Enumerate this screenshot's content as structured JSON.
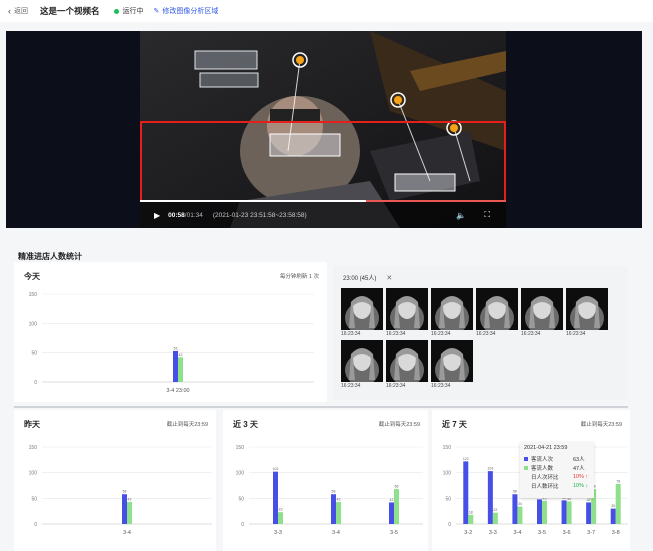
{
  "topbar": {
    "back_label": "返回",
    "video_name": "这是一个视频名",
    "status_label": "运行中",
    "edit_label": "修改图像分析区域"
  },
  "player": {
    "current_time": "00:58",
    "duration": "/01:34",
    "time_range": "(2021-01-23 23:51:58~23:58:58)",
    "progress": 0.617
  },
  "section_title": "精准进店人数统计",
  "colors": {
    "blue": "#4650e6",
    "green": "#8fe08a",
    "accent": "#2f57e8",
    "roi": "#e5201a"
  },
  "panels": {
    "today": {
      "title": "今天",
      "note": "每分钟刷新 1 次"
    },
    "yesterday": {
      "title": "昨天",
      "note": "截止到每天23:59"
    },
    "last3": {
      "title": "近 3 天",
      "note": "截止到每天23:59"
    },
    "last7": {
      "title": "近 7 天",
      "note": "截止到每天23:59"
    }
  },
  "faces": {
    "header": "23:00 (45人)",
    "items": [
      "16:23:34",
      "16:23:34",
      "16:23:34",
      "16:23:34",
      "16:23:34",
      "16:23:34",
      "16:23:34",
      "16:23:34",
      "16:23:34"
    ]
  },
  "tooltip": {
    "title": "2021-04-21 23:59",
    "rows": [
      {
        "label": "客流人次",
        "value": "63人",
        "kind": "blue"
      },
      {
        "label": "客流人数",
        "value": "47人",
        "kind": "green"
      },
      {
        "label": "日人次环比",
        "value": "10% ↑",
        "kind": "up"
      },
      {
        "label": "日人数环比",
        "value": "10% ↓",
        "kind": "down"
      }
    ]
  },
  "chart_data": [
    {
      "type": "bar",
      "panel": "today",
      "categories": [
        "3-4 23:00"
      ],
      "series": [
        {
          "values": [
            53
          ]
        },
        {
          "values": [
            42
          ]
        }
      ],
      "ylim": [
        0,
        150
      ],
      "yticks": [
        0,
        50,
        100,
        150
      ]
    },
    {
      "type": "bar",
      "panel": "yesterday",
      "categories": [
        "3-4"
      ],
      "series": [
        {
          "values": [
            58
          ]
        },
        {
          "values": [
            43
          ]
        }
      ],
      "ylim": [
        0,
        150
      ],
      "yticks": [
        0,
        50,
        100,
        150
      ]
    },
    {
      "type": "bar",
      "panel": "last3",
      "categories": [
        "3-3",
        "3-4",
        "3-5"
      ],
      "series": [
        {
          "values": [
            102,
            58,
            42
          ]
        },
        {
          "values": [
            23,
            43,
            68
          ]
        }
      ],
      "ylim": [
        0,
        150
      ],
      "yticks": [
        0,
        50,
        100,
        150
      ]
    },
    {
      "type": "bar",
      "panel": "last7",
      "categories": [
        "3-2",
        "3-3",
        "3-4",
        "3-5",
        "3-6",
        "3-7",
        "3-8"
      ],
      "series": [
        {
          "values": [
            122,
            103,
            58,
            48,
            46,
            42,
            30
          ]
        },
        {
          "values": [
            18,
            22,
            34,
            45,
            44,
            68,
            78
          ]
        }
      ],
      "ylim": [
        0,
        150
      ],
      "yticks": [
        0,
        50,
        100,
        150
      ]
    }
  ]
}
